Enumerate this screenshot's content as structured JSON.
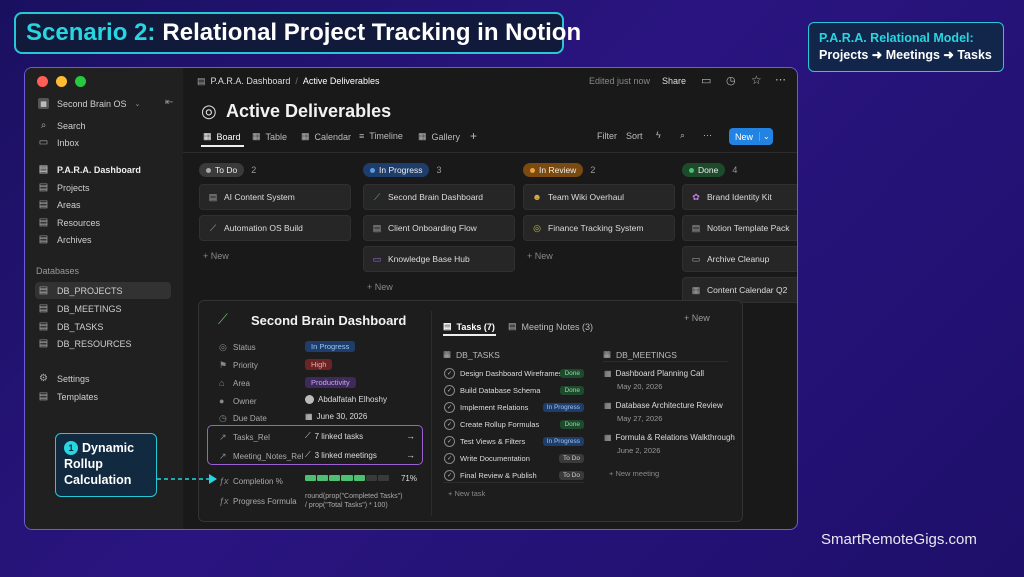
{
  "slide": {
    "title_accent": "Scenario 2:",
    "title_rest": "Relational Project Tracking in Notion",
    "para_line1": "P.A.R.A. Relational Model:",
    "para_line2": "Projects ➜ Meetings ➜ Tasks",
    "callout_number": "1",
    "callout_text_1": "Dynamic",
    "callout_text_2": "Rollup",
    "callout_text_3": "Calculation",
    "watermark": "SmartRemoteGigs.com"
  },
  "sidebar": {
    "workspace": "Second Brain OS",
    "search": "Search",
    "inbox": "Inbox",
    "para_dashboard": "P.A.R.A. Dashboard",
    "projects": "Projects",
    "areas": "Areas",
    "resources": "Resources",
    "archives": "Archives",
    "databases_label": "Databases",
    "db_projects": "DB_PROJECTS",
    "db_meetings": "DB_MEETINGS",
    "db_tasks": "DB_TASKS",
    "db_resources": "DB_RESOURCES",
    "settings": "Settings",
    "templates": "Templates"
  },
  "topbar": {
    "breadcrumb_1": "P.A.R.A. Dashboard",
    "breadcrumb_sep": "/",
    "breadcrumb_2": "Active Deliverables",
    "edited": "Edited just now",
    "share": "Share"
  },
  "page": {
    "title": "Active Deliverables"
  },
  "views": {
    "board": "Board",
    "table": "Table",
    "calendar": "Calendar",
    "timeline": "Timeline",
    "gallery": "Gallery",
    "add": "+",
    "filter": "Filter",
    "sort": "Sort",
    "new": "New"
  },
  "board": {
    "todo": {
      "label": "To Do",
      "count": "2",
      "cards": [
        "AI Content System",
        "Automation OS Build"
      ],
      "new": "+ New"
    },
    "inprogress": {
      "label": "In Progress",
      "count": "3",
      "cards": [
        "Second Brain Dashboard",
        "Client Onboarding Flow",
        "Knowledge Base Hub"
      ],
      "new": "+ New"
    },
    "inreview": {
      "label": "In Review",
      "count": "2",
      "cards": [
        "Team Wiki Overhaul",
        "Finance Tracking System"
      ],
      "new": "+ New"
    },
    "done": {
      "label": "Done",
      "count": "4",
      "cards": [
        "Brand Identity Kit",
        "Notion Template Pack",
        "Archive Cleanup",
        "Content Calendar Q2"
      ]
    }
  },
  "panel": {
    "title": "Second Brain Dashboard",
    "props": {
      "status_name": "Status",
      "status_value": "In Progress",
      "priority_name": "Priority",
      "priority_value": "High",
      "area_name": "Area",
      "area_value": "Productivity",
      "owner_name": "Owner",
      "owner_value": "Abdalfatah Elhoshy",
      "due_name": "Due Date",
      "due_value": "June 30, 2026",
      "tasks_rel_name": "Tasks_Rel",
      "tasks_rel_value": "7 linked tasks",
      "meet_rel_name": "Meeting_Notes_Rel",
      "meet_rel_value": "3 linked meetings",
      "completion_name": "Completion %",
      "completion_value": "71%",
      "completion_fraction": 0.71,
      "formula_name": "Progress Formula",
      "formula_line1": "round(prop(\"Completed Tasks\")",
      "formula_line2": "/ prop(\"Total Tasks\") * 100)"
    },
    "tab_tasks": "Tasks (7)",
    "tab_meetings": "Meeting Notes (3)",
    "new": "+ New",
    "db_tasks": "DB_TASKS",
    "db_meetings": "DB_MEETINGS",
    "tasks": [
      {
        "name": "Design Dashboard Wireframes",
        "status": "Done"
      },
      {
        "name": "Build Database Schema",
        "status": "Done"
      },
      {
        "name": "Implement Relations",
        "status": "In Progress"
      },
      {
        "name": "Create Rollup Formulas",
        "status": "Done"
      },
      {
        "name": "Test Views & Filters",
        "status": "In Progress"
      },
      {
        "name": "Write Documentation",
        "status": "To Do"
      },
      {
        "name": "Final Review & Publish",
        "status": "To Do"
      }
    ],
    "new_task": "+ New task",
    "meetings": [
      {
        "name": "Dashboard Planning Call",
        "date": "May 20, 2026"
      },
      {
        "name": "Database Architecture Review",
        "date": "May 27, 2026"
      },
      {
        "name": "Formula & Relations Walkthrough",
        "date": "June 2, 2026"
      }
    ],
    "new_meeting": "+ New meeting"
  },
  "colors": {
    "accent": "#27d6e0",
    "todo": "#3a3a3a",
    "inprogress": "#1f3d6a",
    "inreview": "#7a4a10",
    "done": "#1e4a2c",
    "new_button": "#2383e2",
    "relation_highlight": "#9b5fd6"
  }
}
